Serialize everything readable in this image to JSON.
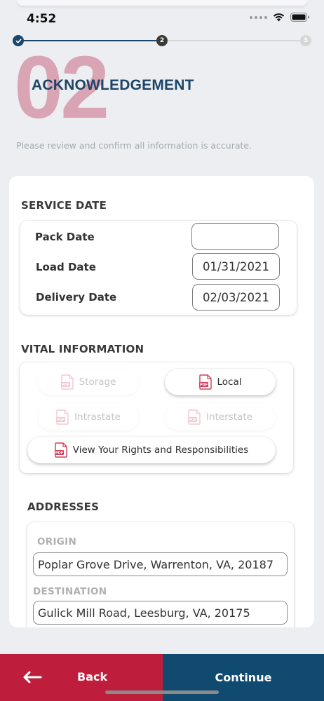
{
  "status": {
    "time": "4:52"
  },
  "stepper": {
    "current_step": "2",
    "next_step": "3",
    "colors": {
      "active": "#1d4568",
      "inactive": "#d6d6d6"
    }
  },
  "header": {
    "number": "02",
    "title": "ACKNOWLEDGEMENT",
    "subtitle": "Please review and confirm all information is accurate."
  },
  "service_date": {
    "title": "SERVICE DATE",
    "rows": [
      {
        "label": "Pack Date",
        "value": ""
      },
      {
        "label": "Load Date",
        "value": "01/31/2021"
      },
      {
        "label": "Delivery Date",
        "value": "02/03/2021"
      }
    ]
  },
  "vital_information": {
    "title": "VITAL INFORMATION",
    "documents": [
      {
        "label": "Storage",
        "enabled": false,
        "icon": "pdf-icon"
      },
      {
        "label": "Local",
        "enabled": true,
        "icon": "pdf-icon"
      },
      {
        "label": "Intrastate",
        "enabled": false,
        "icon": "pdf-icon"
      },
      {
        "label": "Interstate",
        "enabled": false,
        "icon": "pdf-icon"
      },
      {
        "label": "View Your Rights and Responsibilities",
        "enabled": true,
        "icon": "pdf-icon"
      }
    ]
  },
  "addresses": {
    "title": "ADDRESSES",
    "origin_label": "ORIGIN",
    "origin": "Poplar Grove Drive, Warrenton, VA, 20187",
    "destination_label": "DESTINATION",
    "destination": "Gulick Mill Road, Leesburg, VA, 20175"
  },
  "footer": {
    "back_label": "Back",
    "continue_label": "Continue",
    "colors": {
      "back": "#be1e3b",
      "continue": "#104a71"
    }
  }
}
